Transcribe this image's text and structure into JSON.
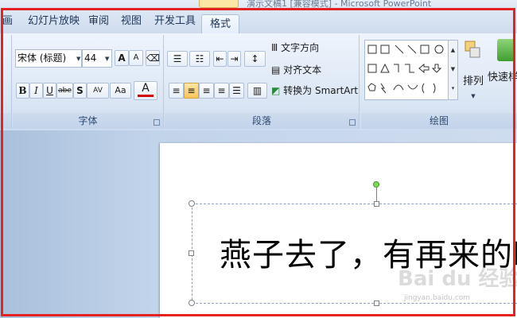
{
  "titlebar": {
    "context_label": "",
    "title": "演示文稿1 [兼容模式] - Microsoft PowerPoint"
  },
  "tabs": [
    {
      "label": "画"
    },
    {
      "label": "幻灯片放映"
    },
    {
      "label": "审阅"
    },
    {
      "label": "视图"
    },
    {
      "label": "开发工具"
    },
    {
      "label": "格式",
      "active": true
    }
  ],
  "font_group": {
    "label": "字体",
    "font_name": "宋体 (标题)",
    "font_size": "44",
    "grow_label": "A",
    "shrink_label": "A",
    "bold": "B",
    "italic": "I",
    "underline": "U",
    "strike": "abe",
    "shadow": "S",
    "spacing": "AV",
    "case": "Aa",
    "color_label": "A",
    "font_color": "#d40000"
  },
  "paragraph_group": {
    "label": "段落",
    "text_direction": "文字方向",
    "align_text": "对齐文本",
    "smartart": "转换为 SmartArt",
    "align_center_active": true
  },
  "drawing_group": {
    "label": "绘图",
    "arrange": "排列",
    "quick_styles": "快速样"
  },
  "slide": {
    "text": "燕子去了，有再来的时候，"
  },
  "watermark": {
    "text": "Bai du 经验",
    "sub": "jingyan.baidu.com"
  },
  "colors": {
    "highlight_frame": "#e52222",
    "ribbon": "#dbe6f4",
    "rotate_handle": "#7ed957"
  }
}
